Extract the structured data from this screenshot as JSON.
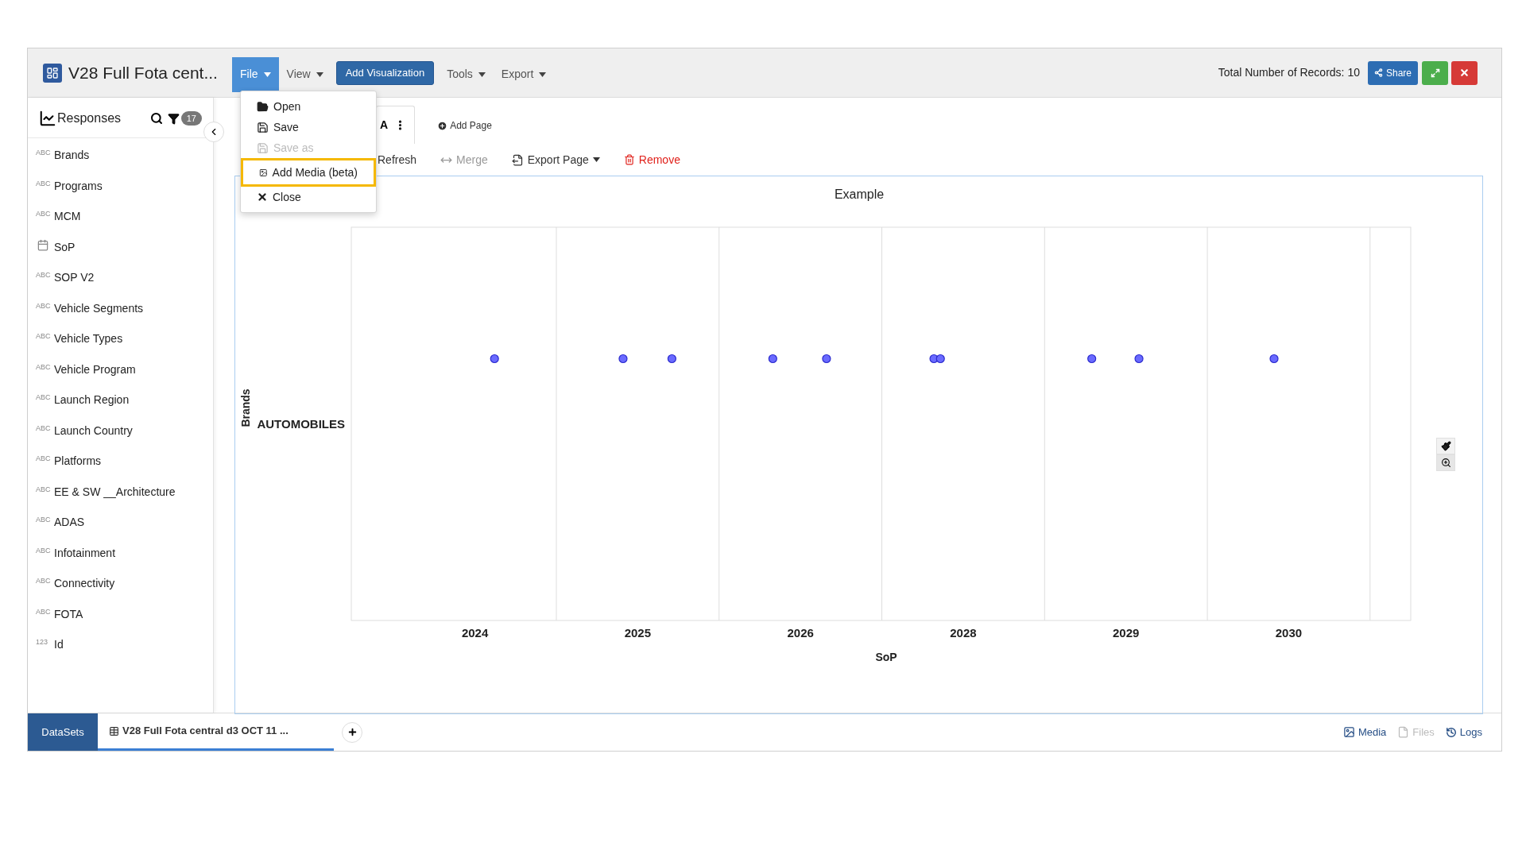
{
  "app": {
    "title": "V28 Full Fota cent...",
    "menus": [
      {
        "label": "File",
        "kind": "menu",
        "selected": true
      },
      {
        "label": "View",
        "kind": "menu",
        "selected": false
      },
      {
        "label": "Add Visualization",
        "kind": "button",
        "selected": false
      },
      {
        "label": "Tools",
        "kind": "menu",
        "selected": false
      },
      {
        "label": "Export",
        "kind": "menu",
        "selected": false
      }
    ],
    "records": "Total Number of Records: 10",
    "share": "Share"
  },
  "file_menu": [
    {
      "label": "Open",
      "kind": "open",
      "disabled": false,
      "selected": false
    },
    {
      "label": "Save",
      "kind": "save",
      "disabled": false,
      "selected": false
    },
    {
      "label": "Save as",
      "kind": "save",
      "disabled": true,
      "selected": false
    },
    {
      "label": "Add Media (beta)",
      "kind": "media",
      "disabled": false,
      "selected": true
    },
    {
      "label": "Close",
      "kind": "close",
      "disabled": false,
      "selected": false
    }
  ],
  "sidebar": {
    "title": "Responses",
    "filter_count": "17",
    "items": [
      {
        "kind": "text",
        "type_label": "ABC",
        "label": "Brands"
      },
      {
        "kind": "text",
        "type_label": "ABC",
        "label": "Programs"
      },
      {
        "kind": "text",
        "type_label": "ABC",
        "label": "MCM"
      },
      {
        "kind": "date",
        "label": "SoP"
      },
      {
        "kind": "text",
        "type_label": "ABC",
        "label": "SOP V2"
      },
      {
        "kind": "text",
        "type_label": "ABC",
        "label": "Vehicle Segments"
      },
      {
        "kind": "text",
        "type_label": "ABC",
        "label": "Vehicle Types"
      },
      {
        "kind": "text",
        "type_label": "ABC",
        "label": "Vehicle Program"
      },
      {
        "kind": "text",
        "type_label": "ABC",
        "label": "Launch Region"
      },
      {
        "kind": "text",
        "type_label": "ABC",
        "label": "Launch Country"
      },
      {
        "kind": "text",
        "type_label": "ABC",
        "label": "Platforms"
      },
      {
        "kind": "text",
        "type_label": "ABC",
        "label": "EE & SW __Architecture"
      },
      {
        "kind": "text",
        "type_label": "ABC",
        "label": "ADAS"
      },
      {
        "kind": "text",
        "type_label": "ABC",
        "label": "Infotainment"
      },
      {
        "kind": "text",
        "type_label": "ABC",
        "label": "Connectivity"
      },
      {
        "kind": "text",
        "type_label": "ABC",
        "label": "FOTA"
      },
      {
        "kind": "text",
        "type_label": "123",
        "label": "Id"
      }
    ]
  },
  "page_tab": {
    "label": "A"
  },
  "add_page": "Add Page",
  "toolbar": [
    {
      "label": "Refresh",
      "kind": "refresh",
      "disabled": false
    },
    {
      "label": "Merge",
      "kind": "merge",
      "disabled": true
    },
    {
      "label": "Export Page",
      "kind": "export",
      "disabled": false
    },
    {
      "label": "Remove",
      "kind": "remove",
      "disabled": false
    }
  ],
  "chart": {
    "title": "Example",
    "x_axis_title": "SoP",
    "y_axis_title": "Brands",
    "x_labels": [
      "2024",
      "2025",
      "2026",
      "2028",
      "2029",
      "2030"
    ],
    "y_labels": [
      "AUTOMOBILES"
    ]
  },
  "footer": {
    "datasets": "DataSets",
    "dataset_tab": "V28 Full Fota central d3 OCT 11 ...",
    "links": [
      {
        "label": "Media",
        "kind": "media",
        "disabled": false
      },
      {
        "label": "Files",
        "kind": "files",
        "disabled": true
      },
      {
        "label": "Logs",
        "kind": "logs",
        "disabled": false
      }
    ]
  }
}
